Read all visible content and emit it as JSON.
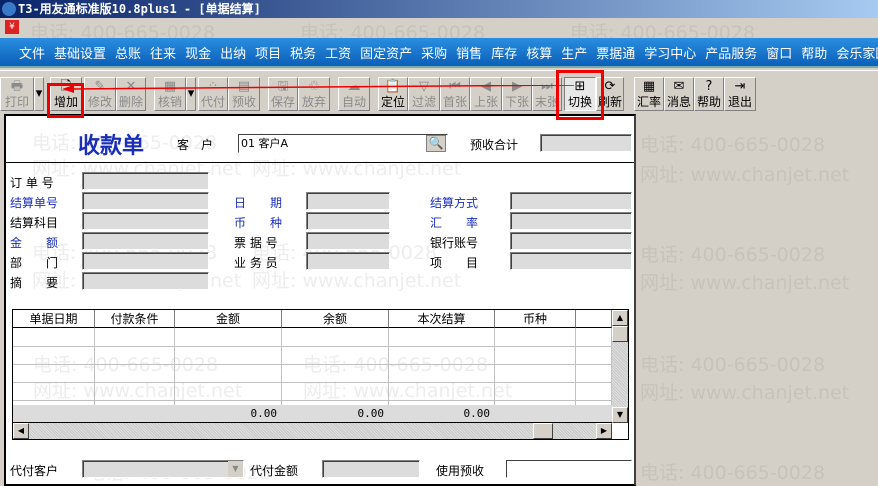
{
  "window": {
    "title": "T3-用友通标准版10.8plus1 - [单据结算]"
  },
  "watermark": {
    "phone": "电话: 400-665-0028",
    "site": "网址: www.chanjet.net"
  },
  "menu": [
    "文件",
    "基础设置",
    "总账",
    "往来",
    "现金",
    "出纳",
    "项目",
    "税务",
    "工资",
    "固定资产",
    "采购",
    "销售",
    "库存",
    "核算",
    "生产",
    "票据通",
    "学习中心",
    "产品服务",
    "窗口",
    "帮助",
    "会乐家园"
  ],
  "toolbar": {
    "print": "打印",
    "add": "增加",
    "edit": "修改",
    "delete": "删除",
    "verify": "核销",
    "proxy": "代付",
    "prepay": "预收",
    "save": "保存",
    "discard": "放弃",
    "auto": "自动",
    "locate": "定位",
    "filter": "过滤",
    "first": "首张",
    "prev": "上张",
    "next": "下张",
    "last": "末张",
    "switch": "切换",
    "refresh": "刷新",
    "rate": "汇率",
    "message": "消息",
    "help": "帮助",
    "exit": "退出"
  },
  "form": {
    "title": "收款单",
    "customer_label": "客　户",
    "customer_value": "01  客户A",
    "prepay_total_label": "预收合计",
    "fields": {
      "order_no": "订 单 号",
      "settle_no": "结算单号",
      "settle_subject": "结算科目",
      "amount": "金　　额",
      "dept": "部　　门",
      "summary": "摘　　要",
      "date": "日　　期",
      "currency": "币　　种",
      "bill_no": "票 据 号",
      "salesman": "业 务 员",
      "settle_method": "结算方式",
      "exchange_rate": "汇　　率",
      "bank_account": "银行账号",
      "project": "项　　目"
    }
  },
  "grid": {
    "columns": [
      "单据日期",
      "付款条件",
      "金额",
      "余额",
      "本次结算",
      "币种"
    ],
    "totals": {
      "amount": "0.00",
      "balance": "0.00",
      "settle": "0.00"
    }
  },
  "footer": {
    "proxy_customer": "代付客户",
    "proxy_amount": "代付金额",
    "use_prepay": "使用预收"
  }
}
